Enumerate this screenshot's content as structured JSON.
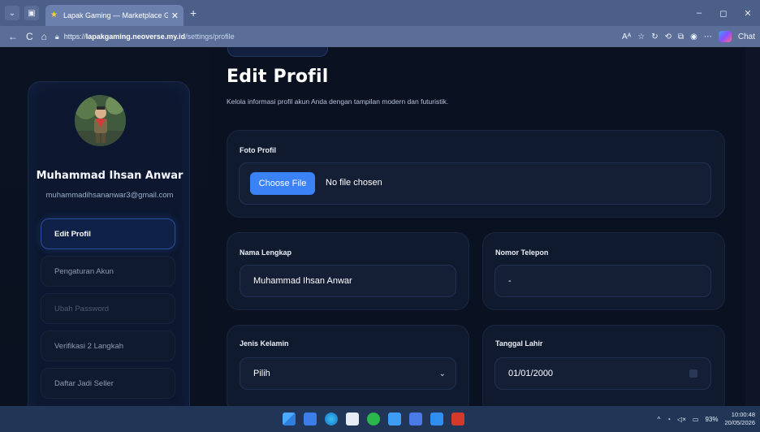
{
  "browser": {
    "tab_title": "Lapak Gaming — Marketplace Gar",
    "tab_close": "✕",
    "new_tab": "+",
    "url_prefix": "https://",
    "url_host": "lapakgaming.neoverse.my.id",
    "url_path": "/settings/profile",
    "copilot_label": "Chat",
    "window_controls": [
      "–",
      "◻",
      "✕"
    ]
  },
  "sidebar": {
    "user_name": "Muhammad Ihsan Anwar",
    "user_email": "muhammadihsananwar3@gmail.com",
    "items": [
      {
        "label": "Edit Profil",
        "state": "active"
      },
      {
        "label": "Pengaturan Akun",
        "state": "normal"
      },
      {
        "label": "Ubah Password",
        "state": "dim"
      },
      {
        "label": "Verifikasi 2 Langkah",
        "state": "normal"
      },
      {
        "label": "Daftar Jadi Seller",
        "state": "normal"
      }
    ]
  },
  "main": {
    "title": "Edit Profil",
    "subtitle": "Kelola informasi profil akun Anda dengan tampilan modern dan futuristik.",
    "photo": {
      "label": "Foto Profil",
      "button": "Choose File",
      "status": "No file chosen"
    },
    "full_name": {
      "label": "Nama Lengkap",
      "value": "Muhammad Ihsan Anwar"
    },
    "phone": {
      "label": "Nomor Telepon",
      "value": "-"
    },
    "gender": {
      "label": "Jenis Kelamin",
      "value": "Pilih"
    },
    "birth_date": {
      "label": "Tanggal Lahir",
      "value": "01/01/2000"
    }
  },
  "taskbar": {
    "battery": "93%",
    "time": "10:00:48",
    "date": "20/05/2026"
  },
  "colors": {
    "accent": "#3b82f6",
    "background": "#0a1120",
    "card": "#0f1a2e",
    "active_item": "#0f2147"
  }
}
